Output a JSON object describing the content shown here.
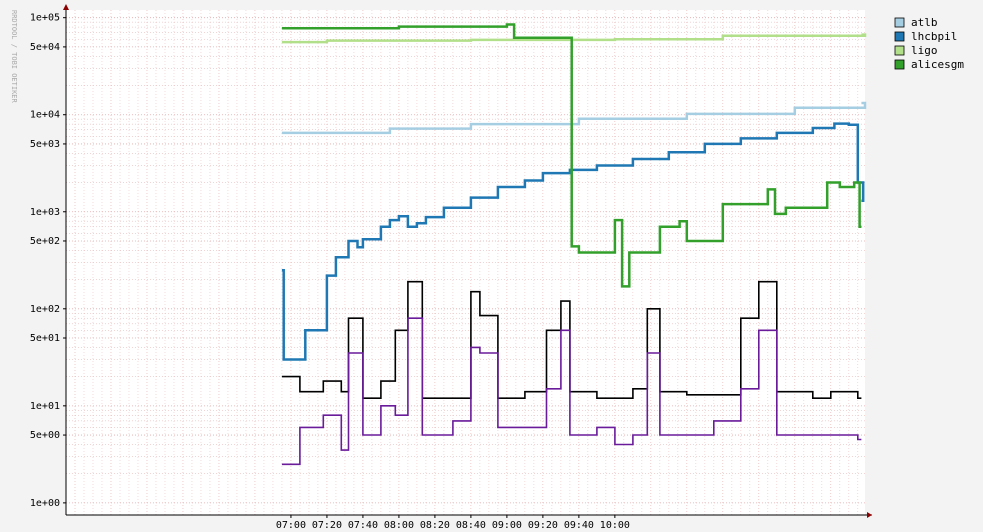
{
  "chart_data": {
    "type": "line",
    "title": "",
    "watermark": "RRDTOOL / TOBI OETIKER",
    "xlabel": "",
    "ylabel": "",
    "y_scale": "log",
    "ylim": [
      0.75,
      120000
    ],
    "x_range_minutes": [
      295,
      739
    ],
    "x_ticks": [
      "07:00",
      "07:20",
      "07:40",
      "08:00",
      "08:20",
      "08:40",
      "09:00",
      "09:20",
      "09:40",
      "10:00"
    ],
    "y_ticks": [
      "1e+00",
      "5e+00",
      "1e+01",
      "5e+01",
      "1e+02",
      "5e+02",
      "1e+03",
      "5e+03",
      "1e+04",
      "5e+04",
      "1e+05"
    ],
    "grid": true,
    "legend_position": "top-right",
    "colors": {
      "atlb": "#a6cee3",
      "lhcbpil": "#1f78b4",
      "ligo": "#b2df8a",
      "alicesgm": "#33a02c",
      "unlabeled_black": "#000000",
      "unlabeled_purple": "#6a1b9a",
      "grid": "#e3aaaa",
      "axis": "#000000"
    },
    "series": [
      {
        "name": "atlb",
        "points": [
          [
            415,
            6500
          ],
          [
            475,
            7200
          ],
          [
            520,
            8000
          ],
          [
            580,
            9100
          ],
          [
            640,
            10200
          ],
          [
            700,
            11800
          ],
          [
            739,
            13200
          ]
        ]
      },
      {
        "name": "lhcbpil",
        "points": [
          [
            415,
            250
          ],
          [
            416,
            30
          ],
          [
            428,
            60
          ],
          [
            440,
            220
          ],
          [
            445,
            340
          ],
          [
            452,
            500
          ],
          [
            457,
            430
          ],
          [
            460,
            520
          ],
          [
            470,
            700
          ],
          [
            475,
            820
          ],
          [
            480,
            900
          ],
          [
            485,
            700
          ],
          [
            490,
            760
          ],
          [
            495,
            880
          ],
          [
            505,
            1100
          ],
          [
            520,
            1400
          ],
          [
            535,
            1800
          ],
          [
            550,
            2100
          ],
          [
            560,
            2500
          ],
          [
            575,
            2700
          ],
          [
            590,
            3000
          ],
          [
            610,
            3500
          ],
          [
            630,
            4100
          ],
          [
            650,
            5000
          ],
          [
            670,
            5700
          ],
          [
            690,
            6500
          ],
          [
            710,
            7300
          ],
          [
            722,
            8100
          ],
          [
            730,
            7900
          ],
          [
            735,
            2000
          ],
          [
            738,
            1300
          ]
        ]
      },
      {
        "name": "ligo",
        "points": [
          [
            415,
            56000
          ],
          [
            440,
            58000
          ],
          [
            520,
            59000
          ],
          [
            600,
            60000
          ],
          [
            660,
            65000
          ],
          [
            739,
            67000
          ]
        ]
      },
      {
        "name": "alicesgm",
        "points": [
          [
            415,
            78000
          ],
          [
            480,
            81000
          ],
          [
            540,
            85000
          ],
          [
            544,
            62000
          ],
          [
            574,
            62000
          ],
          [
            576,
            440
          ],
          [
            580,
            380
          ],
          [
            600,
            820
          ],
          [
            604,
            170
          ],
          [
            608,
            380
          ],
          [
            625,
            700
          ],
          [
            636,
            800
          ],
          [
            640,
            500
          ],
          [
            660,
            1200
          ],
          [
            685,
            1700
          ],
          [
            689,
            950
          ],
          [
            695,
            1100
          ],
          [
            718,
            2000
          ],
          [
            725,
            1800
          ],
          [
            733,
            2000
          ],
          [
            736,
            700
          ]
        ]
      },
      {
        "points": [
          [
            415,
            20
          ],
          [
            425,
            14
          ],
          [
            438,
            18
          ],
          [
            448,
            14
          ],
          [
            452,
            80
          ],
          [
            460,
            12
          ],
          [
            470,
            18
          ],
          [
            478,
            60
          ],
          [
            485,
            190
          ],
          [
            493,
            12
          ],
          [
            510,
            12
          ],
          [
            520,
            150
          ],
          [
            525,
            85
          ],
          [
            535,
            12
          ],
          [
            550,
            14
          ],
          [
            562,
            60
          ],
          [
            570,
            120
          ],
          [
            575,
            14
          ],
          [
            590,
            12
          ],
          [
            600,
            12
          ],
          [
            610,
            15
          ],
          [
            618,
            100
          ],
          [
            625,
            14
          ],
          [
            640,
            13
          ],
          [
            655,
            13
          ],
          [
            670,
            80
          ],
          [
            680,
            190
          ],
          [
            690,
            14
          ],
          [
            710,
            12
          ],
          [
            720,
            14
          ],
          [
            735,
            12
          ]
        ]
      },
      {
        "points": [
          [
            415,
            2.5
          ],
          [
            425,
            6
          ],
          [
            438,
            8
          ],
          [
            448,
            3.5
          ],
          [
            452,
            35
          ],
          [
            460,
            5
          ],
          [
            470,
            10
          ],
          [
            478,
            8
          ],
          [
            485,
            80
          ],
          [
            493,
            5
          ],
          [
            510,
            7
          ],
          [
            520,
            40
          ],
          [
            525,
            35
          ],
          [
            535,
            6
          ],
          [
            550,
            6
          ],
          [
            562,
            15
          ],
          [
            570,
            60
          ],
          [
            575,
            5
          ],
          [
            590,
            6
          ],
          [
            600,
            4
          ],
          [
            610,
            5
          ],
          [
            618,
            35
          ],
          [
            625,
            5
          ],
          [
            640,
            5
          ],
          [
            655,
            7
          ],
          [
            670,
            15
          ],
          [
            680,
            60
          ],
          [
            690,
            5
          ],
          [
            710,
            5
          ],
          [
            720,
            5
          ],
          [
            735,
            4.5
          ]
        ]
      }
    ]
  }
}
